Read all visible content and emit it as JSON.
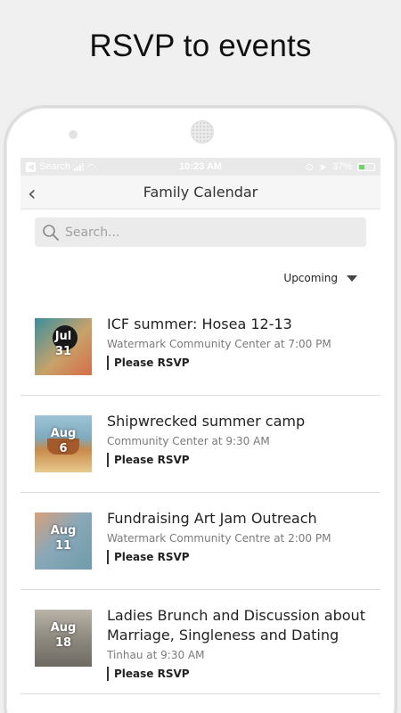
{
  "headline": "RSVP to events",
  "status": {
    "carrier": "Search",
    "time": "10:23 AM",
    "battery": "37%"
  },
  "nav": {
    "title": "Family Calendar"
  },
  "search": {
    "placeholder": "Search..."
  },
  "filter": {
    "selected": "Upcoming"
  },
  "events": [
    {
      "title": "ICF summer: Hosea 12-13",
      "location": "Watermark Community Center at 7:00 PM",
      "month": "Jul",
      "day": "31",
      "action": "Please RSVP"
    },
    {
      "title": "Shipwrecked summer camp",
      "location": "Community Center at 9:30 AM",
      "month": "Aug",
      "day": "6",
      "action": "Please RSVP"
    },
    {
      "title": "Fundraising Art Jam Outreach",
      "location": "Watermark Community Centre at 2:00 PM",
      "month": "Aug",
      "day": "11",
      "action": "Please RSVP"
    },
    {
      "title": "Ladies Brunch and Discussion about Marriage, Singleness and Dating",
      "location": "Tinhau at 9:30 AM",
      "month": "Aug",
      "day": "18",
      "action": "Please RSVP"
    }
  ]
}
